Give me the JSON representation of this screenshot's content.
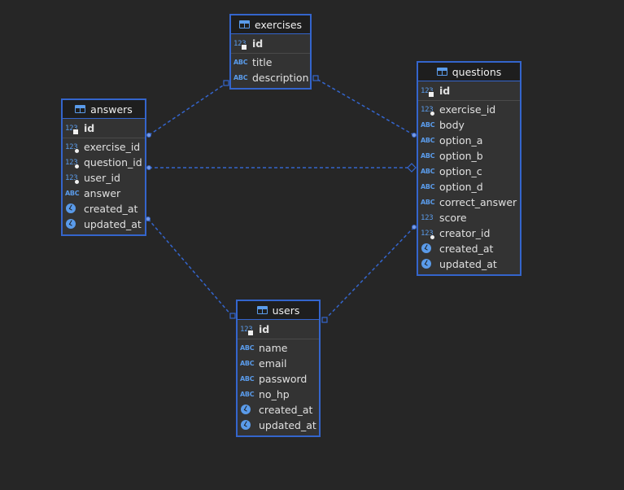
{
  "colors": {
    "background": "#262626",
    "entity_border": "#3465cc",
    "header_bg": "#1e1e1e",
    "icon_blue": "#5a9bea",
    "text": "#e0e0e0"
  },
  "entities": [
    {
      "name": "exercises",
      "columns": [
        {
          "name": "id",
          "type": "number",
          "key": "pk"
        },
        {
          "name": "title",
          "type": "text"
        },
        {
          "name": "description",
          "type": "text"
        }
      ]
    },
    {
      "name": "answers",
      "columns": [
        {
          "name": "id",
          "type": "number",
          "key": "pk"
        },
        {
          "name": "exercise_id",
          "type": "number",
          "key": "fk"
        },
        {
          "name": "question_id",
          "type": "number",
          "key": "fk"
        },
        {
          "name": "user_id",
          "type": "number",
          "key": "fk"
        },
        {
          "name": "answer",
          "type": "text"
        },
        {
          "name": "created_at",
          "type": "datetime"
        },
        {
          "name": "updated_at",
          "type": "datetime"
        }
      ]
    },
    {
      "name": "questions",
      "columns": [
        {
          "name": "id",
          "type": "number",
          "key": "pk"
        },
        {
          "name": "exercise_id",
          "type": "number",
          "key": "fk"
        },
        {
          "name": "body",
          "type": "text"
        },
        {
          "name": "option_a",
          "type": "text"
        },
        {
          "name": "option_b",
          "type": "text"
        },
        {
          "name": "option_c",
          "type": "text"
        },
        {
          "name": "option_d",
          "type": "text"
        },
        {
          "name": "correct_answer",
          "type": "text"
        },
        {
          "name": "score",
          "type": "number"
        },
        {
          "name": "creator_id",
          "type": "number",
          "key": "fk"
        },
        {
          "name": "created_at",
          "type": "datetime"
        },
        {
          "name": "updated_at",
          "type": "datetime"
        }
      ]
    },
    {
      "name": "users",
      "columns": [
        {
          "name": "id",
          "type": "number",
          "key": "pk"
        },
        {
          "name": "name",
          "type": "text"
        },
        {
          "name": "email",
          "type": "text"
        },
        {
          "name": "password",
          "type": "text"
        },
        {
          "name": "no_hp",
          "type": "text"
        },
        {
          "name": "created_at",
          "type": "datetime"
        },
        {
          "name": "updated_at",
          "type": "datetime"
        }
      ]
    }
  ],
  "type_labels": {
    "number": "123",
    "text": "ABC"
  },
  "relationships": [
    {
      "from": "answers.exercise_id",
      "to": "exercises.id"
    },
    {
      "from": "answers.question_id",
      "to": "questions.id"
    },
    {
      "from": "answers.user_id",
      "to": "users.id"
    },
    {
      "from": "questions.exercise_id",
      "to": "exercises.id"
    },
    {
      "from": "questions.creator_id",
      "to": "users.id"
    }
  ]
}
